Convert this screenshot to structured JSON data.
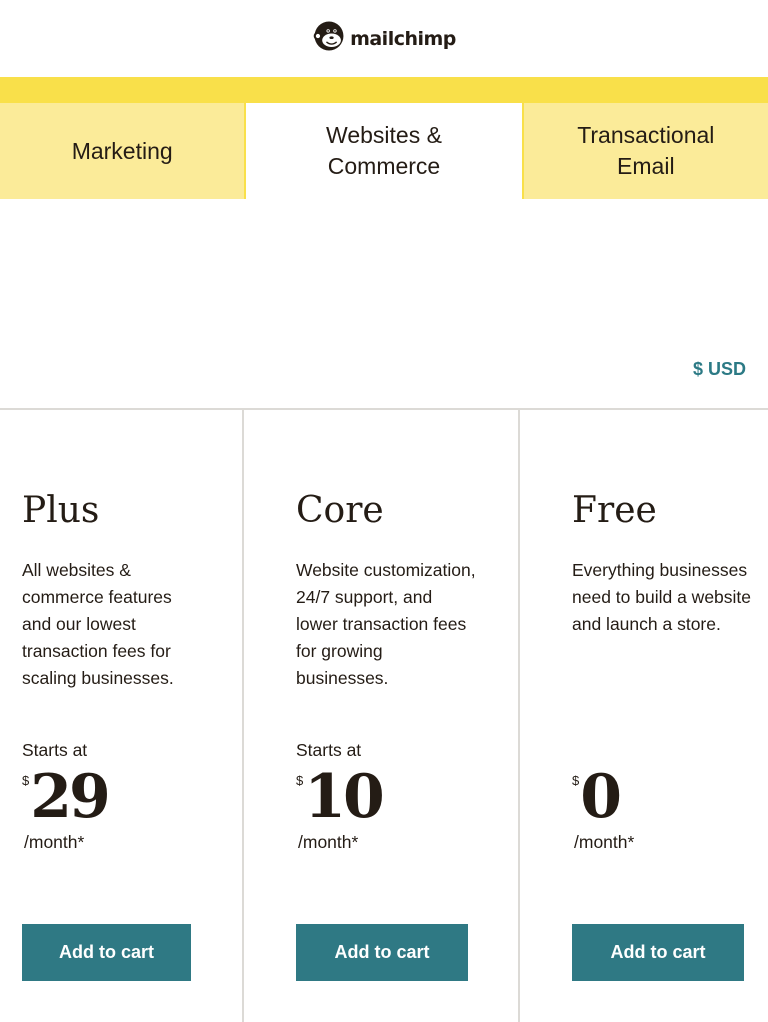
{
  "header": {
    "logo_text": "mailchimp",
    "logo_icon": "freddie-monkey-icon"
  },
  "tabs": [
    {
      "label_line1": "Marketing",
      "label_line2": "",
      "active": false
    },
    {
      "label_line1": "Websites &",
      "label_line2": "Commerce",
      "active": true
    },
    {
      "label_line1": "Transactional",
      "label_line2": "Email",
      "active": false
    }
  ],
  "currency": {
    "label": "$ USD"
  },
  "plans": [
    {
      "name": "Plus",
      "description": "All websites & commerce features and our lowest transaction fees for scaling businesses.",
      "starts_at": "Starts at",
      "currency_symbol": "$",
      "price": "29",
      "per": "/month*",
      "button": "Add to cart"
    },
    {
      "name": "Core",
      "description": "Website customization, 24/7 support, and lower transaction fees for growing businesses.",
      "starts_at": "Starts at",
      "currency_symbol": "$",
      "price": "10",
      "per": "/month*",
      "button": "Add to cart"
    },
    {
      "name": "Free",
      "description": "Everything businesses need to build a website and launch a store.",
      "starts_at": "",
      "currency_symbol": "$",
      "price": "0",
      "per": "/month*",
      "button": "Add to cart"
    }
  ],
  "colors": {
    "brand_yellow": "#f9e04a",
    "tab_inactive": "#fbeb99",
    "button_teal": "#2f7984",
    "currency_teal": "#2c7a85",
    "text_dark": "#241c15"
  }
}
